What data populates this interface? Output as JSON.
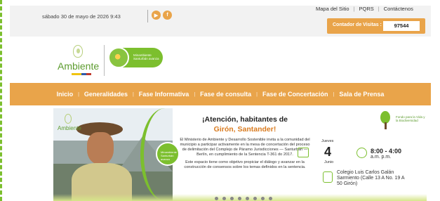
{
  "topbar": {
    "date": "sábado 30 de mayo de 2026 9:43",
    "social_icons": [
      "youtube-icon",
      "facebook-icon"
    ],
    "links": [
      "Mapa del Sitio",
      "PQRS",
      "Contáctenos"
    ],
    "counter_label": "Contador de Visitas :",
    "counter_value": "97544"
  },
  "logo": {
    "name": "Ambiente",
    "badge_text": "Minambiente Santurbán avanza"
  },
  "nav": {
    "items": [
      "Inicio",
      "Generalidades",
      "Fase Informativa",
      "Fase de consulta",
      "Fase de Concertación",
      "Sala de Prensa"
    ]
  },
  "banner": {
    "logo_name": "Ambiente",
    "badge_text": "Minambiente Santurbán avanza",
    "headline_1": "¡Atención, habitantes de",
    "headline_2": "Girón, Santander!",
    "body_1": "El Ministerio de Ambiente y Desarrollo Sostenible invita a la comunidad del municipio a participar activamente en la mesa de concertación del proceso de delimitación del Complejo de Páramo Jurisdicciones — Santurbán — Berlín, en cumplimiento de la Sentencia T-361 do 2017.",
    "body_2": "Este espacio tiene como objetivo propiciar el diálogo y avanzar en la construcción de consensos sobre los temas definidos en la sentencia.",
    "day_label": "Jueves",
    "day_num": "4",
    "month": "Junio",
    "time_main": "8:00 - 4:00",
    "time_sub": "a.m.    p.m.",
    "place": "Colegio Luis Carlos Galán Sarmiento (Calle 13 A No. 19 A 50 Girón)",
    "fondo_text": "Fondo para la Vida y la Biodiversidad",
    "slide_count": 8
  },
  "colors": {
    "accent_orange": "#e9a44a",
    "brand_green": "#7cbf2e",
    "highlight_orange": "#d97b1f"
  }
}
